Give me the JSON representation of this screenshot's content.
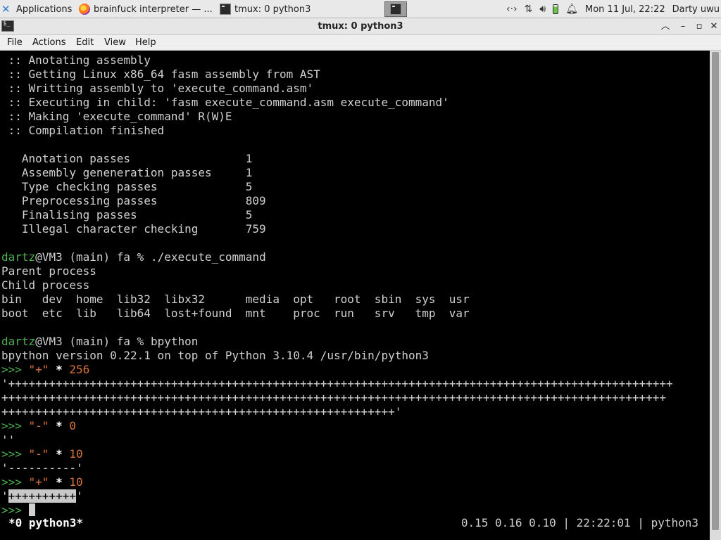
{
  "panel": {
    "tasks": [
      {
        "label": "Applications",
        "icon": "xfce-logo-icon"
      },
      {
        "label": "brainfuck interpreter — ...",
        "icon": "firefox-icon"
      },
      {
        "label": "tmux: 0 python3",
        "icon": "terminal-icon"
      }
    ],
    "tray": {
      "network_icon": "network-icon",
      "transfer_icon": "up-down-arrows-icon",
      "volume_icon": "volume-icon",
      "battery_icon": "battery-icon",
      "notification_icon": "bell-icon",
      "clock": "Mon 11 Jul, 22:22",
      "user": "Darty uwu"
    }
  },
  "window": {
    "title": "tmux: 0 python3"
  },
  "menubar": {
    "items": [
      "File",
      "Actions",
      "Edit",
      "View",
      "Help"
    ]
  },
  "terminal": {
    "compile_log": [
      " :: Anotating assembly",
      " :: Getting Linux x86_64 fasm assembly from AST",
      " :: Writting assembly to 'execute_command.asm'",
      " :: Executing in child: 'fasm execute_command.asm execute_command'",
      " :: Making 'execute_command' R(W)E",
      " :: Compilation finished"
    ],
    "stats": [
      "   Anotation passes                 1",
      "   Assembly geneneration passes     1",
      "   Type checking passes             5",
      "   Preprocessing passes             809",
      "   Finalising passes                5",
      "   Illegal character checking       759"
    ],
    "prompt_user": "dartz",
    "prompt_rest": "@VM3 (main) fa % ",
    "cmd1": "./execute_command",
    "out1": [
      "Parent process",
      "Child process",
      "bin   dev  home  lib32  libx32      media  opt   root  sbin  sys  usr",
      "boot  etc  lib   lib64  lost+found  mnt    proc  run   srv   tmp  var"
    ],
    "cmd2": "bpython",
    "bpython_version": "bpython version 0.22.1 on top of Python 3.10.4 /usr/bin/python3",
    "repl_prompt": ">>> ",
    "r1_str": "\"+\"",
    "r1_op": " * ",
    "r1_num": "256",
    "r1_out": [
      "'++++++++++++++++++++++++++++++++++++++++++++++++++++++++++++++++++++++++++++++++++++++++++++++++++",
      "++++++++++++++++++++++++++++++++++++++++++++++++++++++++++++++++++++++++++++++++++++++++++++++++++",
      "++++++++++++++++++++++++++++++++++++++++++++++++++++++++++'"
    ],
    "r2_str": "\"-\"",
    "r2_num": "0",
    "r2_out": "''",
    "r3_str": "\"-\"",
    "r3_num": "10",
    "r3_out": "'----------'",
    "r4_str": "\"+\"",
    "r4_num": "10",
    "r4_out_q1": "'",
    "r4_out_sel": "++++++++++",
    "r4_out_q2": "'",
    "r5_prompt": ">>> "
  },
  "tmux_status": {
    "left": "*0 python3*",
    "right": "0.15 0.16 0.10 | 22:22:01 | python3"
  }
}
